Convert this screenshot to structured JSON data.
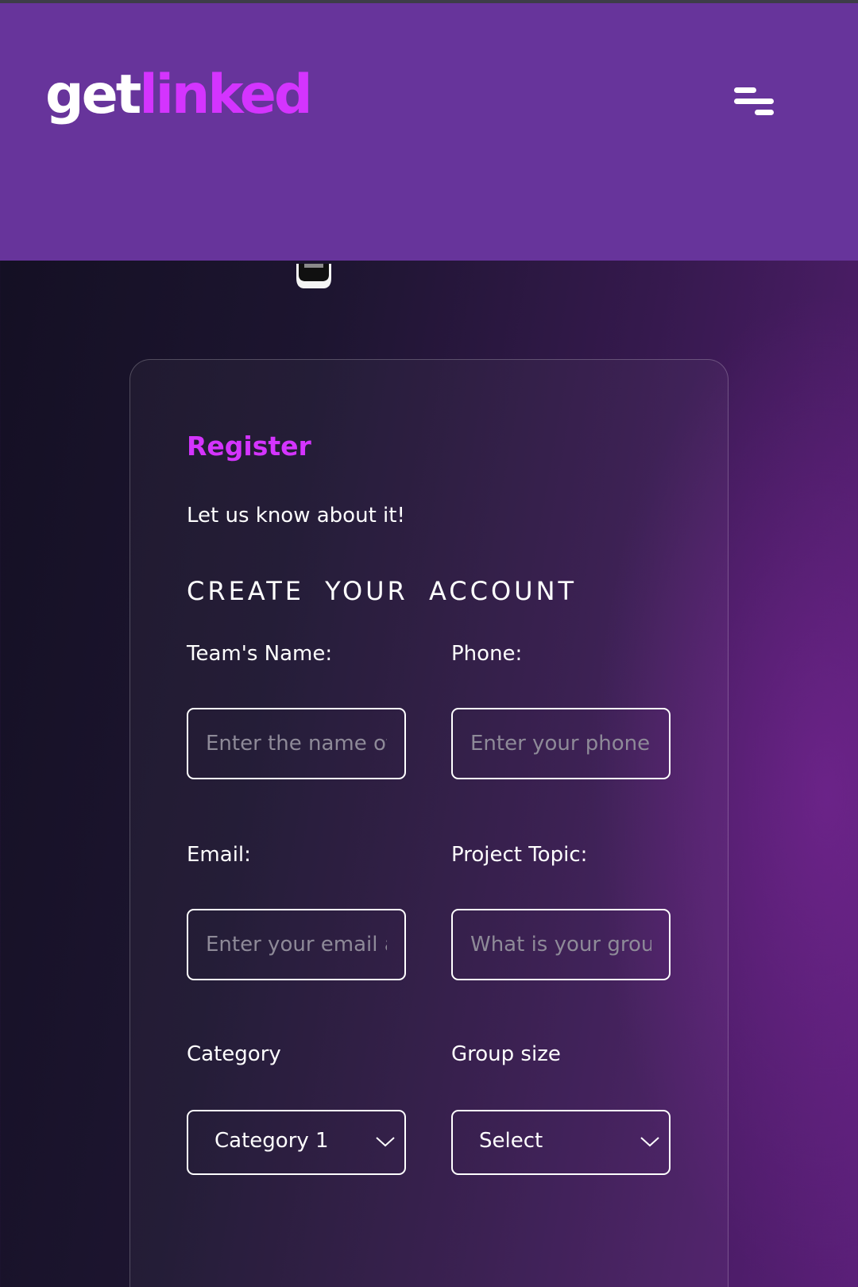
{
  "header": {
    "logo_part1": "get",
    "logo_part2": "linked",
    "logo_accent_color": "#d434fe",
    "background_color": "#67349b",
    "menu_icon": "menu-icon"
  },
  "form": {
    "title": "Register",
    "subtitle": "Let us know about it!",
    "heading": "CREATE YOUR ACCOUNT",
    "fields": {
      "team_name": {
        "label": "Team's Name:",
        "placeholder": "Enter the name of your group",
        "value": ""
      },
      "phone": {
        "label": "Phone:",
        "placeholder": "Enter your phone number",
        "value": ""
      },
      "email": {
        "label": "Email:",
        "placeholder": "Enter your email address",
        "value": ""
      },
      "project_topic": {
        "label": "Project Topic:",
        "placeholder": "What is your group project topic",
        "value": ""
      },
      "category": {
        "label": "Category",
        "selected": "Category 1"
      },
      "group_size": {
        "label": "Group size",
        "selected": "Select"
      }
    }
  }
}
